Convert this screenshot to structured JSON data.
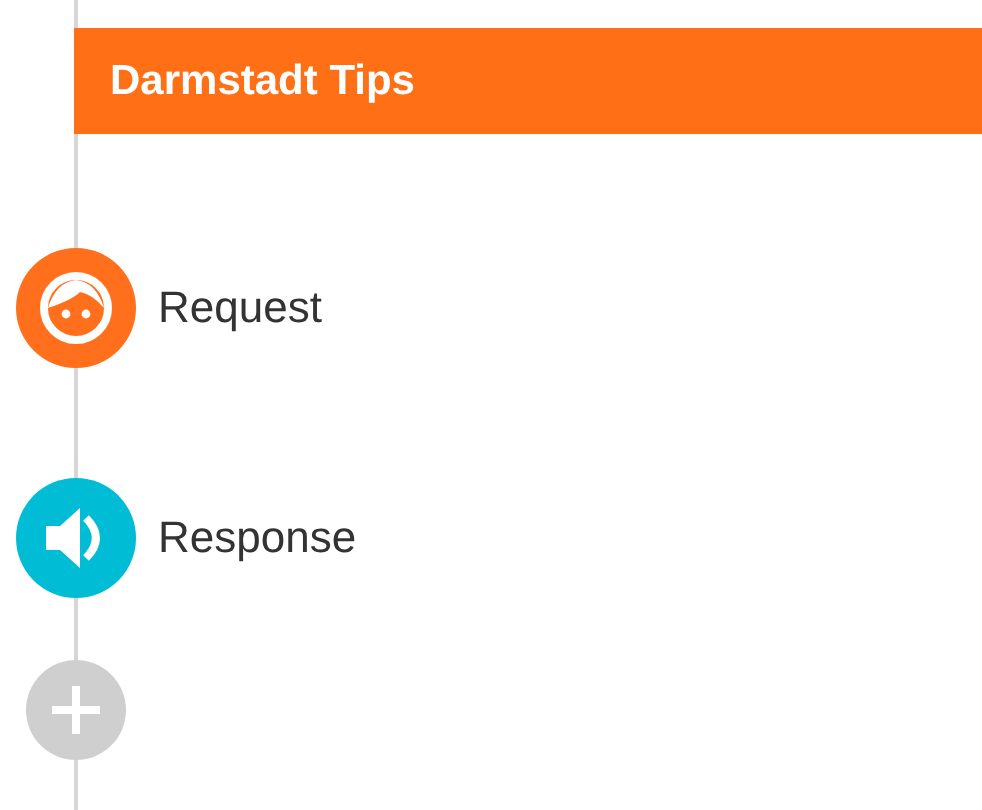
{
  "header": {
    "title": "Darmstadt Tips"
  },
  "steps": [
    {
      "kind": "request",
      "label": "Request",
      "color": "#ff6f1c"
    },
    {
      "kind": "response",
      "label": "Response",
      "color": "#00bcd4"
    }
  ],
  "add_button": {
    "disabled": true
  }
}
